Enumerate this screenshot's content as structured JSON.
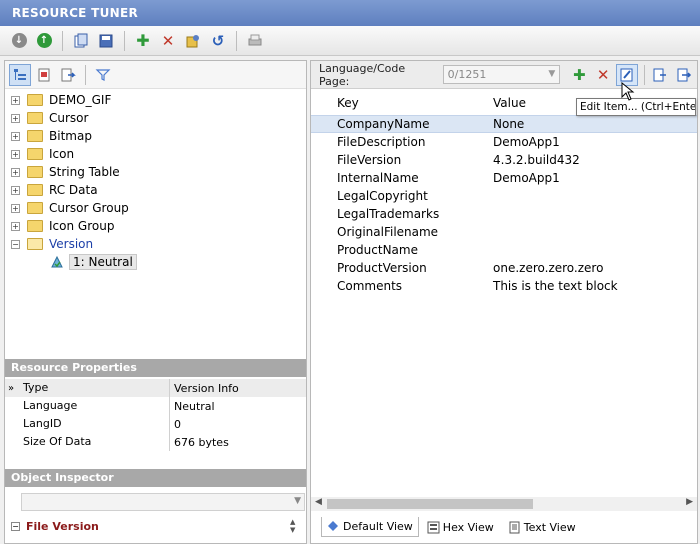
{
  "app": {
    "title": "RESOURCE TUNER"
  },
  "tree": {
    "items": [
      {
        "label": "DEMO_GIF"
      },
      {
        "label": "Cursor"
      },
      {
        "label": "Bitmap"
      },
      {
        "label": "Icon"
      },
      {
        "label": "String Table"
      },
      {
        "label": "RC Data"
      },
      {
        "label": "Cursor Group"
      },
      {
        "label": "Icon Group"
      },
      {
        "label": "Version"
      }
    ],
    "child": {
      "label": "1: Neutral"
    }
  },
  "resource_properties": {
    "title": "Resource Properties",
    "rows": [
      {
        "key": "Type",
        "value": "Version Info"
      },
      {
        "key": "Language",
        "value": "Neutral"
      },
      {
        "key": "LangID",
        "value": "0"
      },
      {
        "key": "Size Of Data",
        "value": "676 bytes"
      }
    ]
  },
  "object_inspector": {
    "title": "Object Inspector",
    "group_label": "File Version"
  },
  "right": {
    "lang_label": "Language/Code Page:",
    "lang_value": "0/1251",
    "columns": {
      "key": "Key",
      "value": "Value"
    },
    "rows": [
      {
        "key": "CompanyName",
        "value": "None"
      },
      {
        "key": "FileDescription",
        "value": "DemoApp1"
      },
      {
        "key": "FileVersion",
        "value": "4.3.2.build432"
      },
      {
        "key": "InternalName",
        "value": "DemoApp1"
      },
      {
        "key": "LegalCopyright",
        "value": ""
      },
      {
        "key": "LegalTrademarks",
        "value": ""
      },
      {
        "key": "OriginalFilename",
        "value": ""
      },
      {
        "key": "ProductName",
        "value": ""
      },
      {
        "key": "ProductVersion",
        "value": "one.zero.zero.zero"
      },
      {
        "key": "Comments",
        "value": "This is the text block"
      }
    ],
    "tabs": [
      {
        "label": "Default View"
      },
      {
        "label": "Hex View"
      },
      {
        "label": "Text View"
      }
    ],
    "tooltip": "Edit Item... (Ctrl+Enter)"
  },
  "colors": {
    "accent": "#5e7fbf",
    "selection": "#dbe6f4",
    "folder": "#f5d56c"
  }
}
